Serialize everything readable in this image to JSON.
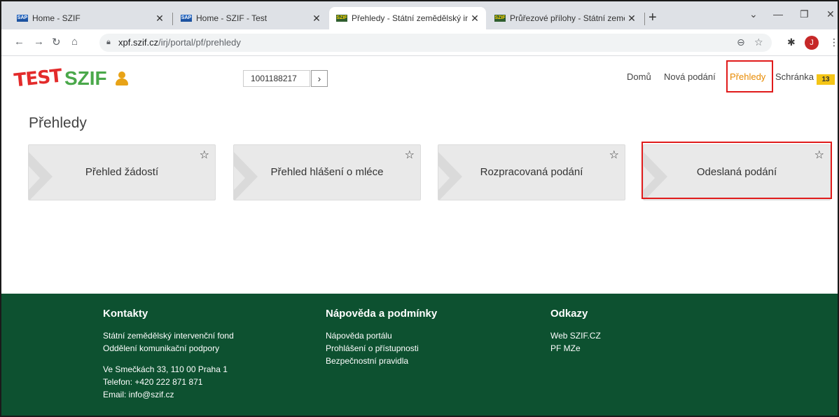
{
  "browser": {
    "tabs": [
      {
        "label": "Home - SZIF",
        "fav": "SAP"
      },
      {
        "label": "Home - SZIF - Test",
        "fav": "SAP"
      },
      {
        "label": "Přehledy - Státní zemědělský inte",
        "fav": "SZIF"
      },
      {
        "label": "Průřezové přílohy - Státní zeměd",
        "fav": "SZIF"
      }
    ],
    "url_host": "xpf.szif.cz",
    "url_path": "/irj/portal/pf/prehledy",
    "avatar_letter": "J"
  },
  "header": {
    "logo_test": "TEST",
    "logo_brand": "SZIF",
    "ident_value": "1001188217",
    "nav": [
      {
        "label": "Domů"
      },
      {
        "label": "Nová podání"
      },
      {
        "label": "Přehledy"
      },
      {
        "label": "Schránka"
      }
    ],
    "inbox_count": "13"
  },
  "main": {
    "title": "Přehledy",
    "cards": [
      {
        "label": "Přehled žádostí"
      },
      {
        "label": "Přehled hlášení o mléce"
      },
      {
        "label": "Rozpracovaná podání"
      },
      {
        "label": "Odeslaná podání"
      }
    ]
  },
  "footer": {
    "contacts": {
      "title": "Kontakty",
      "lines": [
        "Státní zemědělský intervenční fond",
        "Oddělení komunikační podpory"
      ],
      "address": [
        "Ve Smečkách 33, 110 00 Praha 1",
        "Telefon: +420 222 871 871",
        "Email: info@szif.cz"
      ]
    },
    "help": {
      "title": "Nápověda a podmínky",
      "links": [
        "Nápověda portálu",
        "Prohlášení o přístupnosti",
        "Bezpečnostní pravidla"
      ]
    },
    "links": {
      "title": "Odkazy",
      "links": [
        "Web SZIF.CZ",
        "PF MZe"
      ]
    }
  },
  "colors": {
    "brand_green": "#4aa84a",
    "footer_bg": "#0d5130",
    "active_nav": "#e88a00",
    "highlight": "#e01b1b",
    "badge": "#f4c516"
  }
}
